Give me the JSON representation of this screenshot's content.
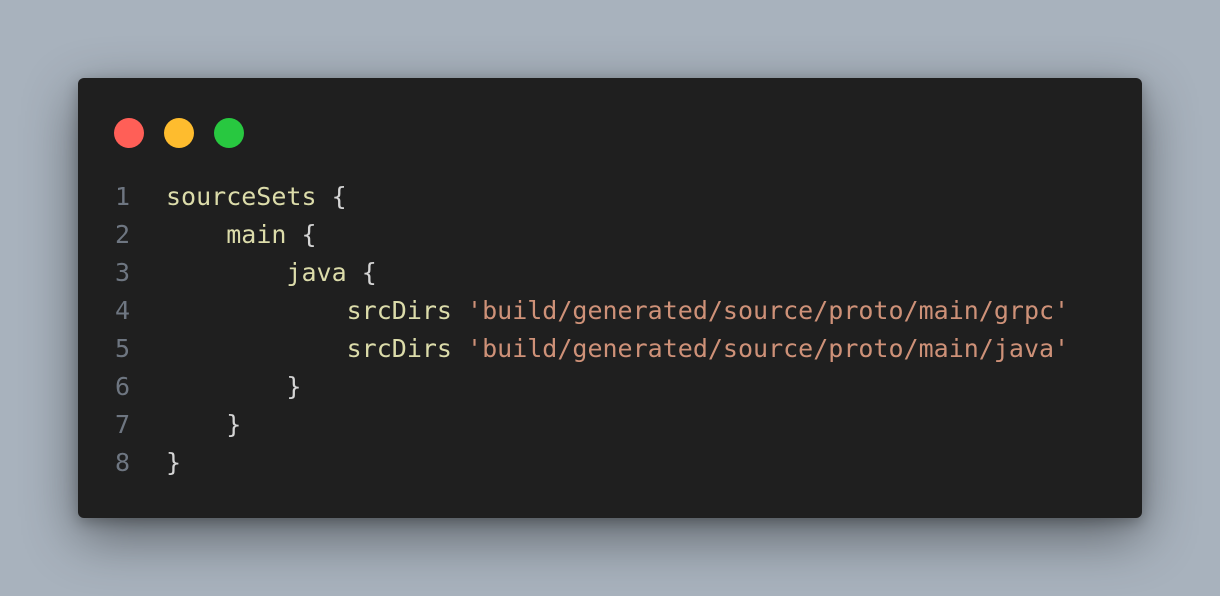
{
  "window": {
    "controls": [
      {
        "name": "close",
        "color": "#ff5f57"
      },
      {
        "name": "minimize",
        "color": "#febc2e"
      },
      {
        "name": "maximize",
        "color": "#28c840"
      }
    ]
  },
  "editor": {
    "language": "gradle",
    "lines": [
      {
        "number": "1",
        "indent": "",
        "ident": "sourceSets",
        "rest": " {",
        "string": ""
      },
      {
        "number": "2",
        "indent": "    ",
        "ident": "main",
        "rest": " {",
        "string": ""
      },
      {
        "number": "3",
        "indent": "        ",
        "ident": "java",
        "rest": " {",
        "string": ""
      },
      {
        "number": "4",
        "indent": "            ",
        "ident": "srcDirs",
        "rest": " ",
        "string": "'build/generated/source/proto/main/grpc'"
      },
      {
        "number": "5",
        "indent": "            ",
        "ident": "srcDirs",
        "rest": " ",
        "string": "'build/generated/source/proto/main/java'"
      },
      {
        "number": "6",
        "indent": "        ",
        "ident": "",
        "rest": "}",
        "string": ""
      },
      {
        "number": "7",
        "indent": "    ",
        "ident": "",
        "rest": "}",
        "string": ""
      },
      {
        "number": "8",
        "indent": "",
        "ident": "",
        "rest": "}",
        "string": ""
      }
    ]
  }
}
